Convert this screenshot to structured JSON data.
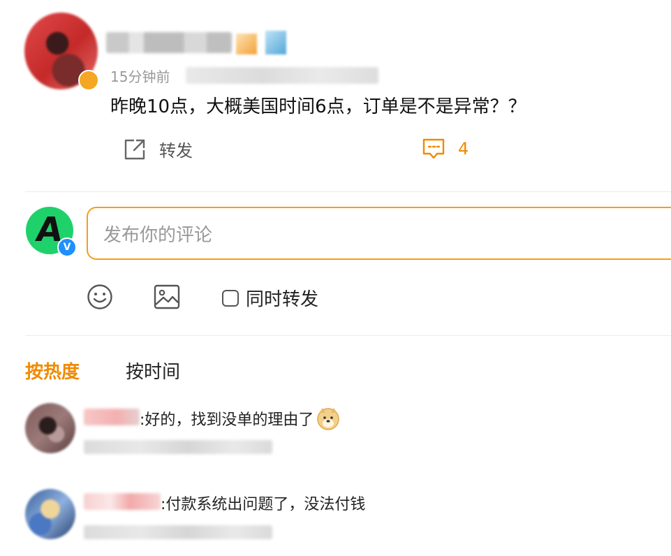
{
  "post": {
    "time": "15分钟前",
    "text": "昨晚10点，大概美国时间6点，订单是不是异常？？",
    "actions": {
      "forward_label": "转发",
      "comment_count": "4"
    }
  },
  "composer": {
    "avatar_letter": "A",
    "verify_mark": "V",
    "placeholder": "发布你的评论",
    "repost_label": "同时转发"
  },
  "sort_tabs": {
    "hot": "按热度",
    "time": "按时间"
  },
  "comments": [
    {
      "text": ":好的，找到没单的理由了",
      "emoji": "doge-emoji"
    },
    {
      "text": ":付款系统出问题了，没法付钱"
    }
  ],
  "colors": {
    "accent": "#f08a00",
    "input_border": "#f79c1b",
    "avatar_green": "#1fd16a",
    "verify_blue": "#1e90ff"
  },
  "icons": [
    "forward-icon",
    "comment-icon",
    "emoji-icon",
    "image-icon",
    "checkbox-icon",
    "doge-emoji"
  ]
}
